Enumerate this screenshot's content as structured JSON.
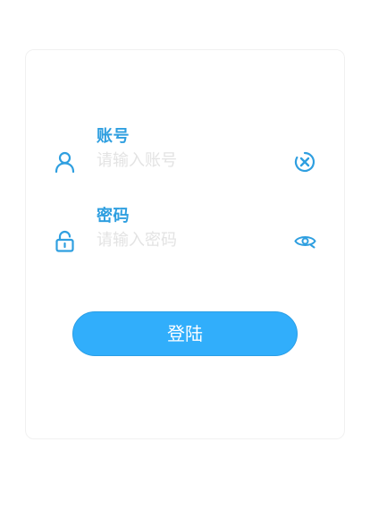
{
  "form": {
    "account": {
      "label": "账号",
      "placeholder": "请输入账号",
      "leading_icon": "user-icon",
      "trailing_icon": "clear-circle-icon"
    },
    "password": {
      "label": "密码",
      "placeholder": "请输入密码",
      "leading_icon": "lock-icon",
      "trailing_icon": "eye-icon"
    },
    "submit_label": "登陆"
  },
  "colors": {
    "accent": "#2f9fe0",
    "button": "#31aefb",
    "placeholder": "#e3e3e3",
    "card_border": "#f1f1f1"
  }
}
